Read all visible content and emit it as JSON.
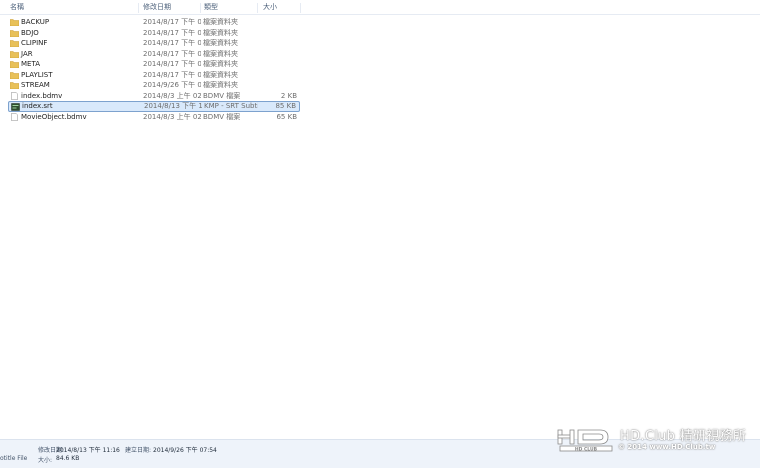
{
  "header": {
    "name": "名稱",
    "modified": "修改日期",
    "type": "類型",
    "size": "大小"
  },
  "files": [
    {
      "name": "BACKUP",
      "date": "2014/8/17 下午 0...",
      "type": "檔案資料夾",
      "size": "",
      "icon": "folder-icon"
    },
    {
      "name": "BDJO",
      "date": "2014/8/17 下午 0...",
      "type": "檔案資料夾",
      "size": "",
      "icon": "folder-icon"
    },
    {
      "name": "CLIPINF",
      "date": "2014/8/17 下午 0...",
      "type": "檔案資料夾",
      "size": "",
      "icon": "folder-icon"
    },
    {
      "name": "JAR",
      "date": "2014/8/17 下午 0...",
      "type": "檔案資料夾",
      "size": "",
      "icon": "folder-icon"
    },
    {
      "name": "META",
      "date": "2014/8/17 下午 0...",
      "type": "檔案資料夾",
      "size": "",
      "icon": "folder-icon"
    },
    {
      "name": "PLAYLIST",
      "date": "2014/8/17 下午 0...",
      "type": "檔案資料夾",
      "size": "",
      "icon": "folder-icon"
    },
    {
      "name": "STREAM",
      "date": "2014/9/26 下午 0...",
      "type": "檔案資料夾",
      "size": "",
      "icon": "folder-icon"
    },
    {
      "name": "index.bdmv",
      "date": "2014/8/3 上午 02...",
      "type": "BDMV 檔案",
      "size": "2 KB",
      "icon": "file-icon"
    },
    {
      "name": "index.srt",
      "date": "2014/8/13 下午 1...",
      "type": "KMP - SRT Subtit...",
      "size": "85 KB",
      "icon": "subtitle-file-icon",
      "selected": true
    },
    {
      "name": "MovieObject.bdmv",
      "date": "2014/8/3 上午 02...",
      "type": "BDMV 檔案",
      "size": "65 KB",
      "icon": "file-icon"
    }
  ],
  "status": {
    "modified_label": "修改日期:",
    "modified_value": "2014/8/13 下午 11:16",
    "created_label": "建立日期:",
    "created_value": "2014/9/26 下午 07:54",
    "type_text": "otitle File",
    "size_label": "大小:",
    "size_value": "84.6 KB"
  },
  "watermark": {
    "title": "HD.Club 精研視務所",
    "subtitle": "© 2014  www.HD.Club.tw",
    "logo_text": "HD CLUB"
  },
  "colors": {
    "selection_bg": "#d9e9fb",
    "selection_border": "#7da2ce",
    "folder": "#e8c15a",
    "status_bg": "#eef3fa"
  }
}
